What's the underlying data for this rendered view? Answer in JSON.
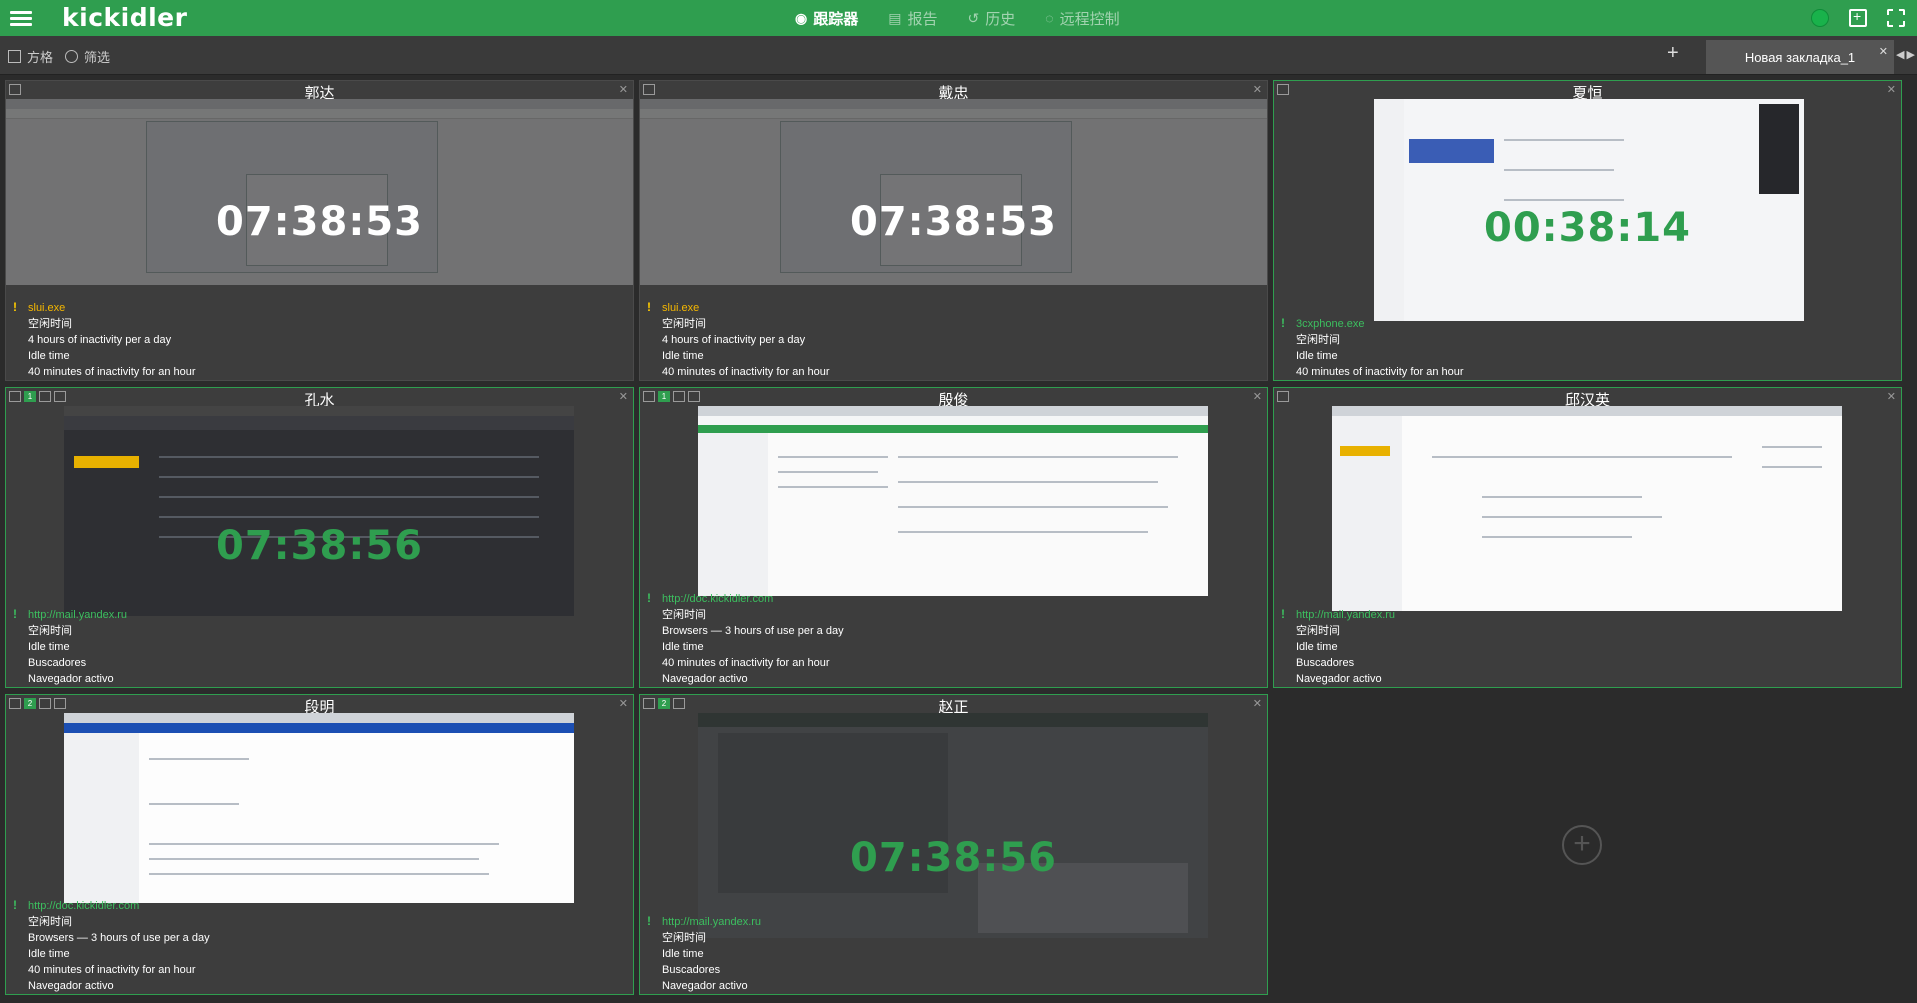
{
  "app": {
    "logo": "kickidler"
  },
  "topnav": [
    {
      "icon": "eye-icon",
      "label": "跟踪器",
      "active": true
    },
    {
      "icon": "report-icon",
      "label": "报告",
      "active": false
    },
    {
      "icon": "history-icon",
      "label": "历史",
      "active": false
    },
    {
      "icon": "remote-control-icon",
      "label": "远程控制",
      "active": false
    }
  ],
  "toolbar": {
    "grid_label": "方格",
    "filter_label": "筛选"
  },
  "tab": {
    "label": "Новая закладка_1"
  },
  "colors": {
    "brand": "#2f9e4f",
    "warning": "#ffcc00",
    "process_orange": "#f5b700"
  },
  "cells": [
    {
      "name": "郭达",
      "time": "07:38:53",
      "time_color": "white",
      "process": "slui.exe",
      "process_color": "orange",
      "lines": [
        "空闲时间",
        "4 hours of inactivity per a day",
        "Idle time",
        "40 minutes of inactivity for an hour"
      ]
    },
    {
      "name": "戴忠",
      "time": "07:38:53",
      "time_color": "white",
      "process": "slui.exe",
      "process_color": "orange",
      "lines": [
        "空闲时间",
        "4 hours of inactivity per a day",
        "Idle time",
        "40 minutes of inactivity for an hour"
      ]
    },
    {
      "name": "夏恒",
      "time": "00:38:14",
      "time_color": "green",
      "process": "3cxphone.exe",
      "process_color": "green",
      "lines": [
        "空闲时间",
        "Idle time",
        "40 minutes of inactivity for an hour"
      ]
    },
    {
      "name": "孔水",
      "time": "07:38:56",
      "time_color": "green",
      "process": "http://mail.yandex.ru",
      "process_color": "green",
      "lines": [
        "空闲时间",
        "Idle time",
        "Buscadores",
        "Navegador activo"
      ]
    },
    {
      "name": "殷俊",
      "time": "",
      "time_color": "green",
      "process": "http://doc.kickidler.com",
      "process_color": "green",
      "lines": [
        "空闲时间",
        "Browsers — 3 hours of use per a day",
        "Idle time",
        "40 minutes of inactivity for an hour",
        "Navegador activo"
      ]
    },
    {
      "name": "邱汉英",
      "time": "",
      "time_color": "green",
      "process": "http://mail.yandex.ru",
      "process_color": "green",
      "lines": [
        "空闲时间",
        "Idle time",
        "Buscadores",
        "Navegador activo"
      ]
    },
    {
      "name": "段明",
      "time": "",
      "time_color": "green",
      "process": "http://doc.kickidler.com",
      "process_color": "green",
      "lines": [
        "空闲时间",
        "Browsers — 3 hours of use per a day",
        "Idle time",
        "40 minutes of inactivity for an hour",
        "Navegador activo"
      ]
    },
    {
      "name": "赵正",
      "time": "07:38:56",
      "time_color": "green",
      "process": "http://mail.yandex.ru",
      "process_color": "green",
      "lines": [
        "空闲时间",
        "Idle time",
        "Buscadores",
        "Navegador activo"
      ]
    }
  ]
}
